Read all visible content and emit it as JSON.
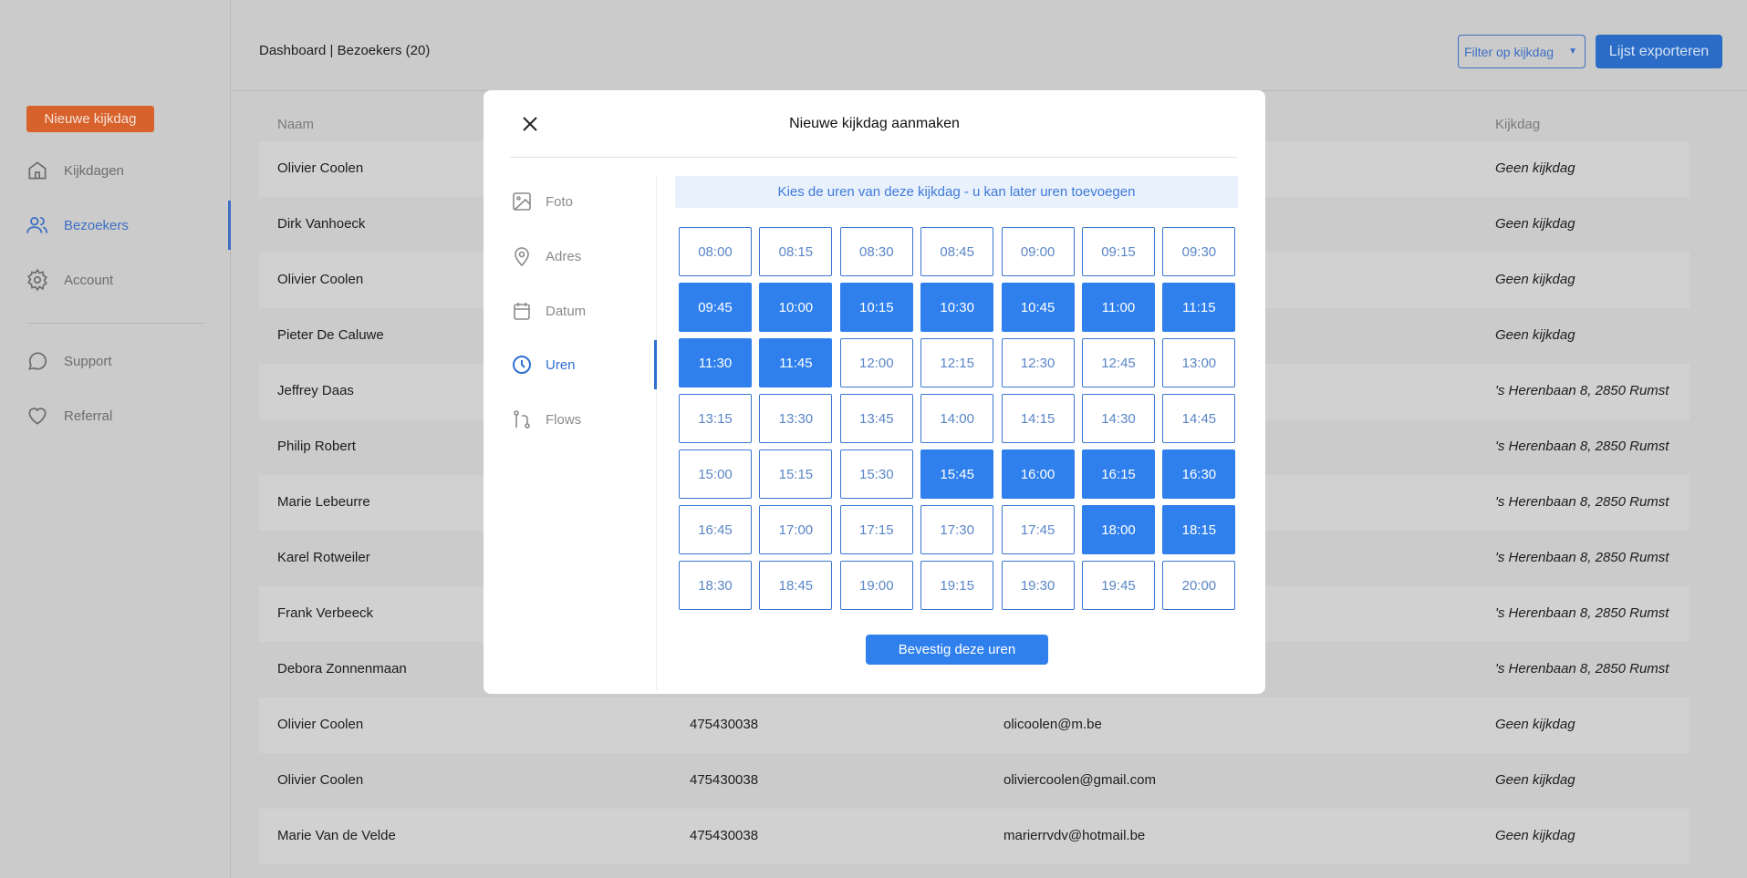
{
  "sidebar": {
    "new_button": "Nieuwe kijkdag",
    "items": [
      {
        "label": "Kijkdagen",
        "icon": "home-icon"
      },
      {
        "label": "Bezoekers",
        "icon": "users-icon",
        "active": true
      },
      {
        "label": "Account",
        "icon": "gear-icon"
      },
      {
        "label": "Support",
        "icon": "chat-bubble-icon"
      },
      {
        "label": "Referral",
        "icon": "heart-icon"
      }
    ]
  },
  "header": {
    "breadcrumb": "Dashboard | Bezoekers (20)",
    "filter": "Filter op kijkdag",
    "export": "Lijst exporteren"
  },
  "table": {
    "headers": {
      "name": "Naam",
      "kijkdag": "Kijkdag"
    },
    "rows": [
      {
        "name": "Olivier Coolen",
        "phone": "",
        "email": "",
        "kijkdag": "Geen kijkdag"
      },
      {
        "name": "Dirk Vanhoeck",
        "phone": "",
        "email": "",
        "kijkdag": "Geen kijkdag"
      },
      {
        "name": "Olivier Coolen",
        "phone": "",
        "email": "",
        "kijkdag": "Geen kijkdag"
      },
      {
        "name": "Pieter De Caluwe",
        "phone": "",
        "email": "",
        "kijkdag": "Geen kijkdag"
      },
      {
        "name": "Jeffrey Daas",
        "phone": "",
        "email": "",
        "kijkdag": "'s Herenbaan 8, 2850 Rumst"
      },
      {
        "name": "Philip Robert",
        "phone": "",
        "email": "",
        "kijkdag": "'s Herenbaan 8, 2850 Rumst"
      },
      {
        "name": "Marie Lebeurre",
        "phone": "",
        "email": "",
        "kijkdag": "'s Herenbaan 8, 2850 Rumst"
      },
      {
        "name": "Karel Rotweiler",
        "phone": "",
        "email": "",
        "kijkdag": "'s Herenbaan 8, 2850 Rumst"
      },
      {
        "name": "Frank Verbeeck",
        "phone": "",
        "email": "",
        "kijkdag": "'s Herenbaan 8, 2850 Rumst"
      },
      {
        "name": "Debora Zonnenmaan",
        "phone": "",
        "email": "",
        "kijkdag": "'s Herenbaan 8, 2850 Rumst"
      },
      {
        "name": "Olivier Coolen",
        "phone": "475430038",
        "email": "olicoolen@m.be",
        "kijkdag": "Geen kijkdag"
      },
      {
        "name": "Olivier Coolen",
        "phone": "475430038",
        "email": "oliviercoolen@gmail.com",
        "kijkdag": "Geen kijkdag"
      },
      {
        "name": "Marie Van de Velde",
        "phone": "475430038",
        "email": "marierrvdv@hotmail.be",
        "kijkdag": "Geen kijkdag"
      }
    ]
  },
  "modal": {
    "title": "Nieuwe kijkdag aanmaken",
    "steps": [
      {
        "label": "Foto",
        "icon": "image-icon"
      },
      {
        "label": "Adres",
        "icon": "map-pin-icon"
      },
      {
        "label": "Datum",
        "icon": "calendar-icon"
      },
      {
        "label": "Uren",
        "icon": "clock-icon",
        "active": true
      },
      {
        "label": "Flows",
        "icon": "git-flow-icon"
      }
    ],
    "banner": "Kies de uren van deze kijkdag - u kan later uren toevoegen",
    "slots": [
      "08:00",
      "08:15",
      "08:30",
      "08:45",
      "09:00",
      "09:15",
      "09:30",
      "09:45",
      "10:00",
      "10:15",
      "10:30",
      "10:45",
      "11:00",
      "11:15",
      "11:30",
      "11:45",
      "12:00",
      "12:15",
      "12:30",
      "12:45",
      "13:00",
      "13:15",
      "13:30",
      "13:45",
      "14:00",
      "14:15",
      "14:30",
      "14:45",
      "15:00",
      "15:15",
      "15:30",
      "15:45",
      "16:00",
      "16:15",
      "16:30",
      "16:45",
      "17:00",
      "17:15",
      "17:30",
      "17:45",
      "18:00",
      "18:15",
      "18:30",
      "18:45",
      "19:00",
      "19:15",
      "19:30",
      "19:45",
      "20:00"
    ],
    "selected": [
      "09:45",
      "10:00",
      "10:15",
      "10:30",
      "10:45",
      "11:00",
      "11:15",
      "11:30",
      "11:45",
      "15:45",
      "16:00",
      "16:15",
      "16:30",
      "18:00",
      "18:15"
    ],
    "confirm": "Bevestig deze uren"
  },
  "colors": {
    "accent": "#2f80ed",
    "orange": "#d8622c",
    "active_nav": "#3c6fc4"
  }
}
